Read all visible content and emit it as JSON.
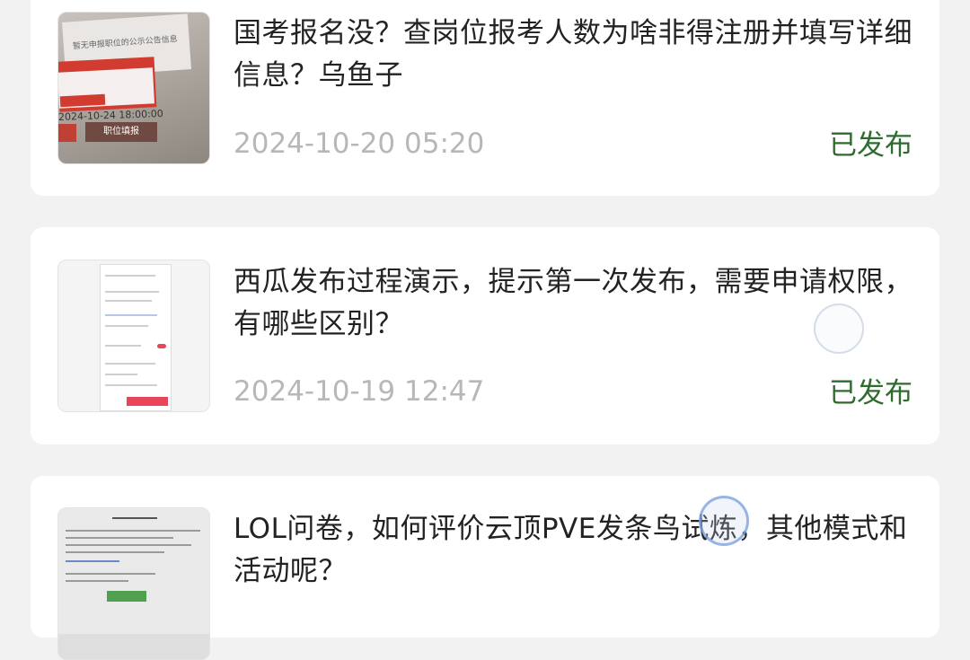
{
  "status_color": "#2f6b2f",
  "items": [
    {
      "title": "国考报名没？查岗位报考人数为啥非得注册并填写详细信息？乌鱼子",
      "date": "2024-10-20 05:20",
      "status": "已发布",
      "thumbnail": {
        "header": "暂无申报职位的公示公告信息",
        "time": "2024-10-24 18:00:00",
        "button": "职位填报"
      }
    },
    {
      "title": "西瓜发布过程演示，提示第一次发布，需要申请权限，有哪些区别？",
      "date": "2024-10-19 12:47",
      "status": "已发布"
    },
    {
      "title": "LOL问卷，如何评价云顶PVE发条鸟试炼，其他模式和活动呢？"
    }
  ]
}
